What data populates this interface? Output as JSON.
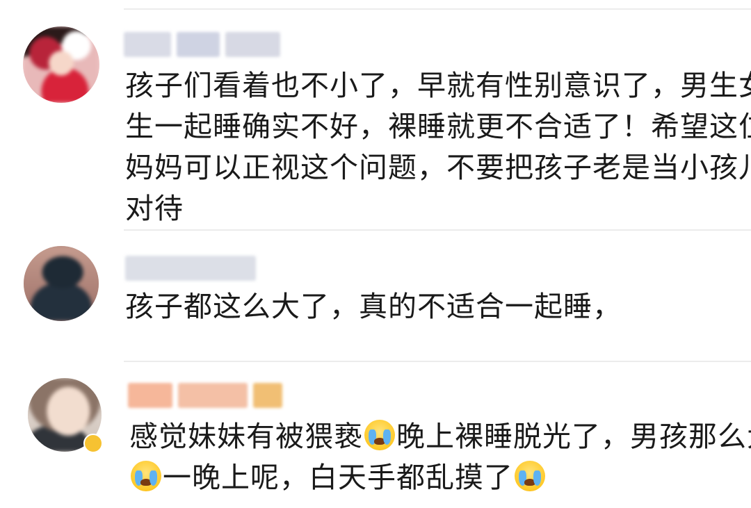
{
  "comments": [
    {
      "username": "",
      "lines": [
        "孩子们看着也不小了，早就有性别意识了，男生女",
        "生一起睡确实不好，裸睡就更不合适了！希望这位",
        "妈妈可以正视这个问题，不要把孩子老是当小孩儿",
        "对待"
      ]
    },
    {
      "username": "",
      "lines": [
        "孩子都这么大了，真的不适合一起睡，"
      ]
    },
    {
      "username": "",
      "line1_a": "感觉妹妹有被猥亵",
      "line1_b": "晚上裸睡脱光了，男孩那么大",
      "line2_a": "一晚上呢，白天手都乱摸了",
      "emoji": "crying-face-icon"
    }
  ],
  "colors": {
    "text": "#1a1a1a",
    "divider": "#ececec",
    "vip_name": "#f4a47a"
  }
}
